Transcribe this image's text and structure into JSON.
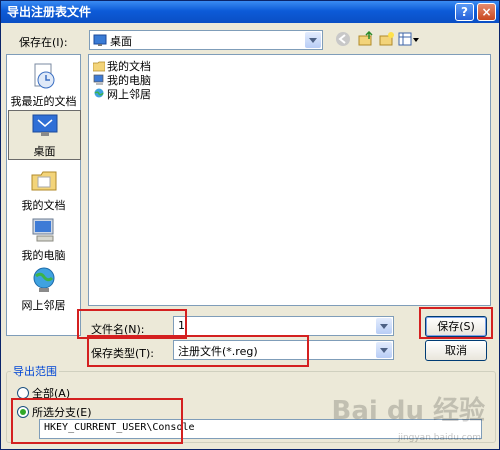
{
  "window": {
    "title": "导出注册表文件"
  },
  "titlebar": {
    "help": "?",
    "close": "×"
  },
  "save_in": {
    "label": "保存在(I):",
    "value": "桌面"
  },
  "places": [
    {
      "label": "我最近的文档",
      "icon": "recent-documents-icon"
    },
    {
      "label": "桌面",
      "icon": "desktop-icon",
      "selected": true
    },
    {
      "label": "我的文档",
      "icon": "my-documents-icon"
    },
    {
      "label": "我的电脑",
      "icon": "my-computer-icon"
    },
    {
      "label": "网上邻居",
      "icon": "network-places-icon"
    }
  ],
  "files": [
    {
      "name": "我的文档",
      "icon": "folder-icon"
    },
    {
      "name": "我的电脑",
      "icon": "computer-icon"
    },
    {
      "name": "网上邻居",
      "icon": "network-icon"
    }
  ],
  "filename": {
    "label": "文件名(N):",
    "value": "1"
  },
  "filetype": {
    "label": "保存类型(T):",
    "value": "注册文件(*.reg)"
  },
  "buttons": {
    "save": "保存(S)",
    "cancel": "取消"
  },
  "export_range": {
    "title": "导出范围",
    "all": "全部(A)",
    "branch": "所选分支(E)",
    "branch_value": "HKEY_CURRENT_USER\\Console",
    "selected": "branch"
  },
  "watermark": {
    "brand": "Bai du 经验",
    "url": "jingyan.baidu.com"
  }
}
